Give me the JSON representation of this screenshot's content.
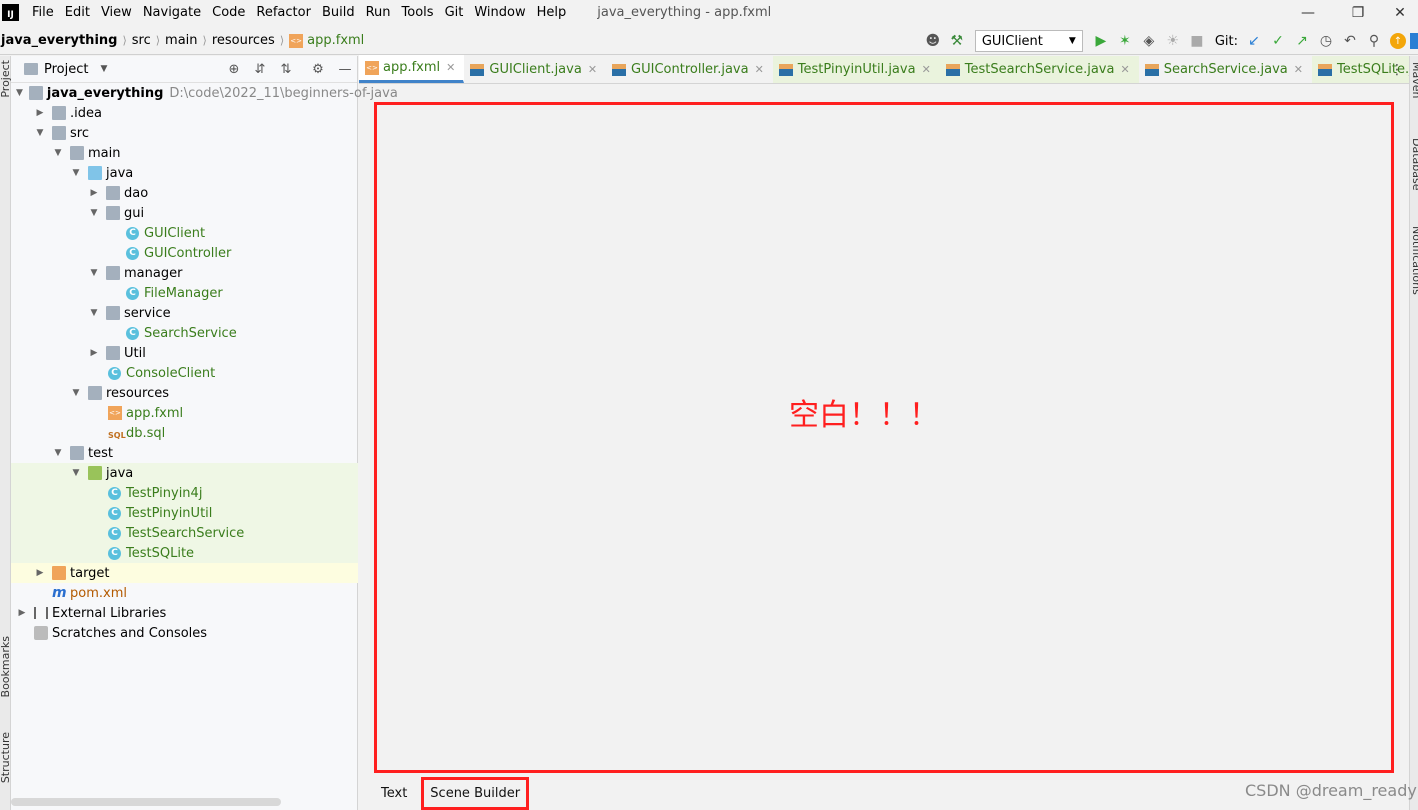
{
  "menubar": {
    "logo": "IJ",
    "items": [
      "File",
      "Edit",
      "View",
      "Navigate",
      "Code",
      "Refactor",
      "Build",
      "Run",
      "Tools",
      "Git",
      "Window",
      "Help"
    ],
    "window_title": "java_everything - app.fxml"
  },
  "breadcrumb": [
    "java_everything",
    "src",
    "main",
    "resources",
    "app.fxml"
  ],
  "toolbar": {
    "run_config": "GUIClient",
    "git_label": "Git:"
  },
  "side_labels": {
    "left_top": "Project",
    "left_mid": "Bookmarks",
    "left_bottom": "Structure",
    "right_top": "Maven",
    "right_mid": "Database",
    "right_bottom": "Notifications"
  },
  "project_panel": {
    "title": "Project",
    "tree": [
      {
        "label": "java_everything",
        "path": "D:\\code\\2022_11\\beginners-of-java"
      },
      {
        "label": ".idea"
      },
      {
        "label": "src"
      },
      {
        "label": "main"
      },
      {
        "label": "java"
      },
      {
        "label": "dao"
      },
      {
        "label": "gui"
      },
      {
        "label": "GUIClient"
      },
      {
        "label": "GUIController"
      },
      {
        "label": "manager"
      },
      {
        "label": "FileManager"
      },
      {
        "label": "service"
      },
      {
        "label": "SearchService"
      },
      {
        "label": "Util"
      },
      {
        "label": "ConsoleClient"
      },
      {
        "label": "resources"
      },
      {
        "label": "app.fxml"
      },
      {
        "label": "db.sql"
      },
      {
        "label": "test"
      },
      {
        "label": "java"
      },
      {
        "label": "TestPinyin4j"
      },
      {
        "label": "TestPinyinUtil"
      },
      {
        "label": "TestSearchService"
      },
      {
        "label": "TestSQLite"
      },
      {
        "label": "target"
      },
      {
        "label": "pom.xml"
      },
      {
        "label": "External Libraries"
      },
      {
        "label": "Scratches and Consoles"
      }
    ]
  },
  "editor_tabs": [
    "app.fxml",
    "GUIClient.java",
    "GUIController.java",
    "TestPinyinUtil.java",
    "TestSearchService.java",
    "SearchService.java",
    "TestSQLite.java"
  ],
  "canvas": {
    "text": "空白！！！"
  },
  "bottom_tabs": [
    "Text",
    "Scene Builder"
  ],
  "watermark": "CSDN @dream_ready",
  "colors": {
    "highlight_red": "#ff1f1f",
    "active_tab_underline": "#4083c9",
    "test_green_bg": "#eff7e5"
  }
}
